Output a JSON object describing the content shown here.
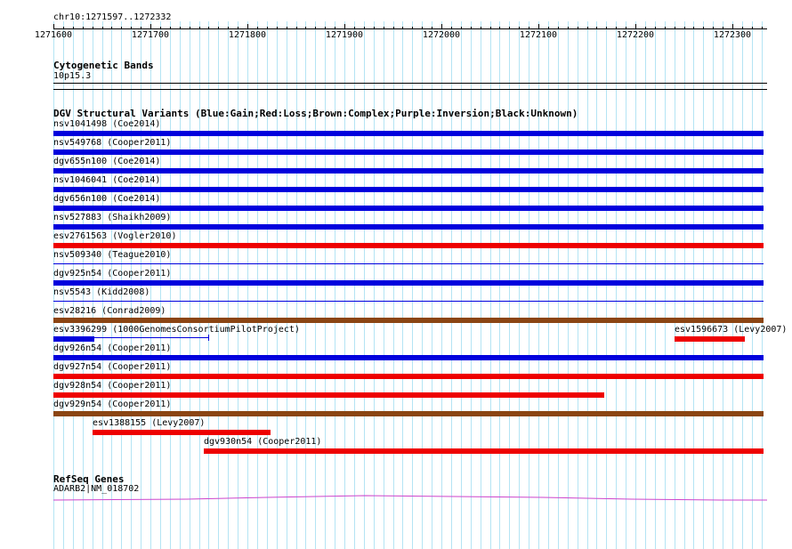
{
  "position_label": "chr10:1271597..1272332",
  "ruler": {
    "ticks": [
      {
        "pos": 1271600,
        "label": "1271600"
      },
      {
        "pos": 1271700,
        "label": "1271700"
      },
      {
        "pos": 1271800,
        "label": "1271800"
      },
      {
        "pos": 1271900,
        "label": "1271900"
      },
      {
        "pos": 1272000,
        "label": "1272000"
      },
      {
        "pos": 1272100,
        "label": "1272100"
      },
      {
        "pos": 1272200,
        "label": "1272200"
      },
      {
        "pos": 1272300,
        "label": "1272300"
      }
    ]
  },
  "tracks": {
    "cytoband": {
      "title": "Cytogenetic Bands",
      "band_label": "10p15.3"
    },
    "dgv": {
      "title": "DGV Structural Variants (Blue:Gain;Red:Loss;Brown:Complex;Purple:Inversion;Black:Unknown)",
      "items": [
        {
          "label": "nsv1041498 (Coe2014)",
          "type": "gain",
          "start": 1271597,
          "end": 1272332,
          "color": "#0000dd"
        },
        {
          "label": "nsv549768 (Cooper2011)",
          "type": "gain",
          "start": 1271597,
          "end": 1272332,
          "color": "#0000dd"
        },
        {
          "label": "dgv655n100 (Coe2014)",
          "type": "gain",
          "start": 1271597,
          "end": 1272332,
          "color": "#0000dd"
        },
        {
          "label": "nsv1046041 (Coe2014)",
          "type": "gain",
          "start": 1271597,
          "end": 1272332,
          "color": "#0000dd"
        },
        {
          "label": "dgv656n100 (Coe2014)",
          "type": "gain",
          "start": 1271597,
          "end": 1272332,
          "color": "#0000dd"
        },
        {
          "label": "nsv527883 (Shaikh2009)",
          "type": "gain",
          "start": 1271597,
          "end": 1272332,
          "color": "#0000dd"
        },
        {
          "label": "esv2761563 (Vogler2010)",
          "type": "loss",
          "start": 1271597,
          "end": 1272332,
          "color": "#ee0000"
        },
        {
          "label": "nsv509340 (Teague2010)",
          "type": "gain",
          "start": 1271597,
          "end": 1272332,
          "color": "#0000dd",
          "thin": true
        },
        {
          "label": "dgv925n54 (Cooper2011)",
          "type": "gain",
          "start": 1271597,
          "end": 1272332,
          "color": "#0000dd"
        },
        {
          "label": "nsv5543 (Kidd2008)",
          "type": "gain",
          "start": 1271597,
          "end": 1272332,
          "color": "#0000dd",
          "thin": true
        },
        {
          "label": "esv28216 (Conrad2009)",
          "type": "complex",
          "start": 1271597,
          "end": 1272332,
          "color": "#8b4513"
        },
        {
          "label": "esv3396299 (1000GenomesConsortiumPilotProject)",
          "type": "gain",
          "start": 1271597,
          "end": 1271642,
          "extend_end": 1271760,
          "color": "#0000dd"
        },
        {
          "label": "esv1596673 (Levy2007)",
          "type": "loss",
          "start": 1272240,
          "end": 1272313,
          "color": "#ee0000",
          "label_inline": true
        },
        {
          "label": "dgv926n54 (Cooper2011)",
          "type": "gain",
          "start": 1271597,
          "end": 1272332,
          "color": "#0000dd"
        },
        {
          "label": "dgv927n54 (Cooper2011)",
          "type": "loss",
          "start": 1271597,
          "end": 1272332,
          "color": "#ee0000"
        },
        {
          "label": "dgv928n54 (Cooper2011)",
          "type": "loss",
          "start": 1271597,
          "end": 1272168,
          "color": "#ee0000"
        },
        {
          "label": "dgv929n54 (Cooper2011)",
          "type": "complex",
          "start": 1271597,
          "end": 1272332,
          "color": "#8b4513"
        },
        {
          "label": "esv1388155 (Levy2007)",
          "type": "loss",
          "start": 1271640,
          "end": 1271824,
          "color": "#ee0000"
        },
        {
          "label": "dgv930n54 (Cooper2011)",
          "type": "loss",
          "start": 1271755,
          "end": 1272332,
          "color": "#ee0000"
        }
      ]
    },
    "refseq": {
      "title": "RefSeq Genes",
      "gene_label": "ADARB2|NM_018702",
      "color": "#cc44cc"
    }
  }
}
